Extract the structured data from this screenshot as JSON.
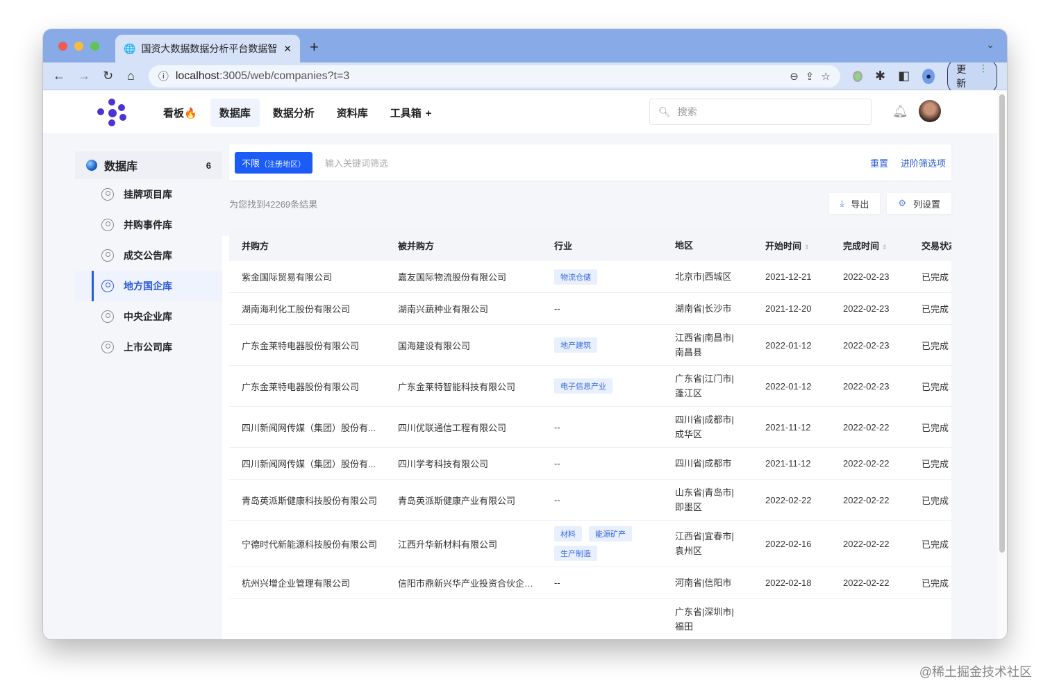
{
  "browser": {
    "tab_title": "国资大数据数据分析平台数据智",
    "url_host": "localhost",
    "url_path": ":3005/web/companies?t=3",
    "update_label": "更新"
  },
  "nav": {
    "items": [
      "看板",
      "数据库",
      "数据分析",
      "资料库",
      "工具箱"
    ],
    "active": 1,
    "fire": "🔥",
    "plus": "+",
    "search_placeholder": "搜索"
  },
  "sidebar": {
    "title": "数据库",
    "count": "6",
    "items": [
      "挂牌项目库",
      "并购事件库",
      "成交公告库",
      "地方国企库",
      "中央企业库",
      "上市公司库"
    ],
    "active": 3
  },
  "filter": {
    "chip": "不限",
    "chip_sub": "（注册地区）",
    "keyword_placeholder": "输入关键词筛选",
    "reset": "重置",
    "advanced": "进阶筛选项"
  },
  "results": {
    "count_text": "为您找到42269条结果",
    "export": "导出",
    "columns_setting": "列设置"
  },
  "table": {
    "headers": [
      "并购方",
      "被并购方",
      "行业",
      "地区",
      "开始时间",
      "完成时间",
      "交易状态"
    ],
    "sortable": [
      4,
      5
    ],
    "rows": [
      [
        "紫金国际贸易有限公司",
        "嘉友国际物流股份有限公司",
        [
          "物流仓储"
        ],
        "北京市|西城区",
        "2021-12-21",
        "2022-02-23",
        "已完成"
      ],
      [
        "湖南海利化工股份有限公司",
        "湖南兴蔬种业有限公司",
        [],
        "湖南省|长沙市",
        "2021-12-20",
        "2022-02-23",
        "已完成"
      ],
      [
        "广东金莱特电器股份有限公司",
        "国海建设有限公司",
        [
          "地产建筑"
        ],
        "江西省|南昌市|南昌县",
        "2022-01-12",
        "2022-02-23",
        "已完成"
      ],
      [
        "广东金莱特电器股份有限公司",
        "广东金莱特智能科技有限公司",
        [
          "电子信息产业"
        ],
        "广东省|江门市|蓬江区",
        "2022-01-12",
        "2022-02-23",
        "已完成"
      ],
      [
        "四川新闻网传媒（集团）股份有...",
        "四川优联通信工程有限公司",
        [],
        "四川省|成都市|成华区",
        "2021-11-12",
        "2022-02-22",
        "已完成"
      ],
      [
        "四川新闻网传媒（集团）股份有...",
        "四川学考科技有限公司",
        [],
        "四川省|成都市",
        "2021-11-12",
        "2022-02-22",
        "已完成"
      ],
      [
        "青岛英派斯健康科技股份有限公司",
        "青岛英派斯健康产业有限公司",
        [],
        "山东省|青岛市|即墨区",
        "2022-02-22",
        "2022-02-22",
        "已完成"
      ],
      [
        "宁德时代新能源科技股份有限公司",
        "江西升华新材料有限公司",
        [
          "材料",
          "能源矿产",
          "生产制造"
        ],
        "江西省|宜春市|袁州区",
        "2022-02-16",
        "2022-02-22",
        "已完成"
      ],
      [
        "杭州兴增企业管理有限公司",
        "信阳市鼎新兴华产业投资合伙企业...",
        [],
        "河南省|信阳市",
        "2022-02-18",
        "2022-02-22",
        "已完成"
      ],
      [
        "",
        "",
        [],
        "广东省|深圳市|福田",
        "",
        "",
        ""
      ]
    ],
    "empty": "--"
  },
  "watermark": "@稀土掘金技术社区"
}
